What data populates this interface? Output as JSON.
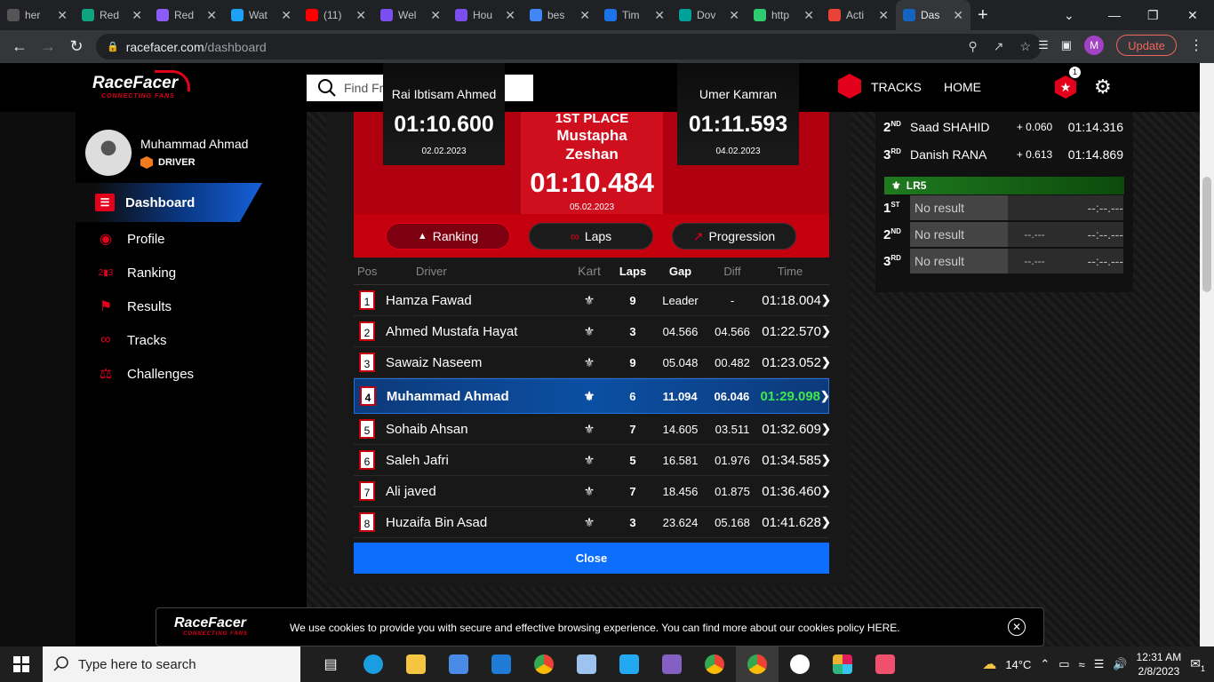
{
  "browser": {
    "tabs": [
      {
        "label": "her",
        "color": "#555"
      },
      {
        "label": "Red",
        "color": "#10a37f"
      },
      {
        "label": "Red",
        "color": "#8b5cf6"
      },
      {
        "label": "Wat",
        "color": "#1da1f2"
      },
      {
        "label": "(11)",
        "color": "#ff0000"
      },
      {
        "label": "Wel",
        "color": "#7b4ef0"
      },
      {
        "label": "Hou",
        "color": "#7b4ef0"
      },
      {
        "label": "bes",
        "color": "#4285f4"
      },
      {
        "label": "Tim",
        "color": "#1a73e8"
      },
      {
        "label": "Dov",
        "color": "#00a19a"
      },
      {
        "label": "http",
        "color": "#2ecc71"
      },
      {
        "label": "Acti",
        "color": "#ea4335"
      },
      {
        "label": "Das",
        "color": "#1565c0"
      }
    ],
    "url_domain": "racefacer.com",
    "url_path": "/dashboard",
    "profile_initial": "M",
    "update_label": "Update"
  },
  "site": {
    "logo_text": "RaceFacer",
    "logo_tagline": "CONNECTING FANS",
    "search_placeholder": "Find Friends",
    "nav": {
      "tracks": "TRACKS",
      "home": "HOME",
      "notif_count": "1"
    }
  },
  "sidebar": {
    "user_name": "Muhammad Ahmad",
    "user_role": "DRIVER",
    "items": [
      {
        "label": "Dashboard",
        "icon": "dashboard-icon"
      },
      {
        "label": "Profile",
        "icon": "helmet-icon"
      },
      {
        "label": "Ranking",
        "icon": "podium-icon"
      },
      {
        "label": "Results",
        "icon": "flag-icon"
      },
      {
        "label": "Tracks",
        "icon": "track-icon"
      },
      {
        "label": "Challenges",
        "icon": "challenge-icon"
      }
    ]
  },
  "podium": {
    "second": {
      "name": "Rai Ibtisam Ahmed",
      "time": "01:10.600",
      "date": "02.02.2023"
    },
    "first": {
      "place": "1ST PLACE",
      "name_line1": "Mustapha",
      "name_line2": "Zeshan",
      "time": "01:10.484",
      "date": "05.02.2023"
    },
    "third": {
      "name": "Umer Kamran",
      "time": "01:11.593",
      "date": "04.02.2023"
    }
  },
  "tabs": {
    "ranking": "Ranking",
    "laps": "Laps",
    "progression": "Progression"
  },
  "results": {
    "headers": {
      "pos": "Pos",
      "driver": "Driver",
      "kart": "Kart",
      "laps": "Laps",
      "gap": "Gap",
      "diff": "Diff",
      "time": "Time"
    },
    "rows": [
      {
        "pos": "1",
        "driver": "Hamza Fawad",
        "laps": "9",
        "gap": "Leader",
        "diff": "-",
        "time": "01:18.004"
      },
      {
        "pos": "2",
        "driver": "Ahmed Mustafa Hayat",
        "laps": "3",
        "gap": "04.566",
        "diff": "04.566",
        "time": "01:22.570"
      },
      {
        "pos": "3",
        "driver": "Sawaiz Naseem",
        "laps": "9",
        "gap": "05.048",
        "diff": "00.482",
        "time": "01:23.052"
      },
      {
        "pos": "4",
        "driver": "Muhammad Ahmad",
        "laps": "6",
        "gap": "11.094",
        "diff": "06.046",
        "time": "01:29.098"
      },
      {
        "pos": "5",
        "driver": "Sohaib Ahsan",
        "laps": "7",
        "gap": "14.605",
        "diff": "03.511",
        "time": "01:32.609"
      },
      {
        "pos": "6",
        "driver": "Saleh Jafri",
        "laps": "5",
        "gap": "16.581",
        "diff": "01.976",
        "time": "01:34.585"
      },
      {
        "pos": "7",
        "driver": "Ali javed",
        "laps": "7",
        "gap": "18.456",
        "diff": "01.875",
        "time": "01:36.460"
      },
      {
        "pos": "8",
        "driver": "Huzaifa Bin Asad",
        "laps": "3",
        "gap": "23.624",
        "diff": "05.168",
        "time": "01:41.628"
      }
    ],
    "close_label": "Close"
  },
  "right_panel": {
    "top_rows": [
      {
        "rank": "2",
        "suffix": "ND",
        "name": "Saad SHAHID",
        "gap": "+ 0.060",
        "time": "01:14.316"
      },
      {
        "rank": "3",
        "suffix": "RD",
        "name": "Danish RANA",
        "gap": "+ 0.613",
        "time": "01:14.869"
      }
    ],
    "section_title": "LR5",
    "lr5_rows": [
      {
        "rank": "1",
        "suffix": "ST",
        "name": "No result",
        "gap": "",
        "time": "--:--.---"
      },
      {
        "rank": "2",
        "suffix": "ND",
        "name": "No result",
        "gap": "--.---",
        "time": "--:--.---"
      },
      {
        "rank": "3",
        "suffix": "RD",
        "name": "No result",
        "gap": "--.---",
        "time": "--:--.---"
      }
    ]
  },
  "cookie": {
    "text": "We use cookies to provide you with secure and effective browsing experience. You can find more about our cookies policy HERE."
  },
  "taskbar": {
    "search_placeholder": "Type here to search",
    "weather": "14°C",
    "time": "12:31 AM",
    "date": "2/8/2023",
    "notif_count": "1"
  }
}
